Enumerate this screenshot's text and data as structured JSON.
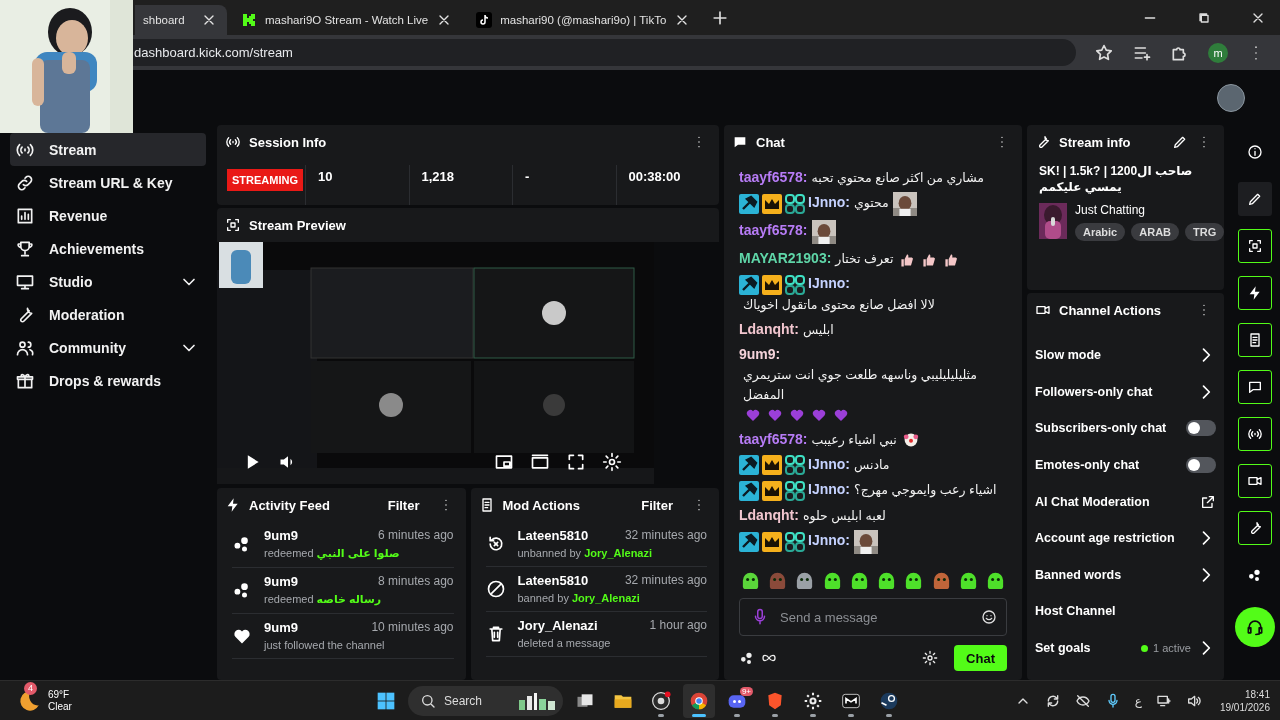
{
  "webcam": {
    "kind": "picture"
  },
  "browser": {
    "tabs": [
      {
        "label": "shboard",
        "selected": true,
        "kind": "page"
      },
      {
        "label": "mashari9O Stream - Watch Live",
        "selected": false,
        "kind": "kick"
      },
      {
        "label": "mashari90 (@mashari9o) | TikTo",
        "selected": false,
        "kind": "tiktok"
      }
    ],
    "url": "dashboard.kick.com/stream",
    "profile": "m"
  },
  "sidebar": {
    "items": [
      {
        "label": "Stream",
        "kind": "stream",
        "selected": true,
        "expandable": false
      },
      {
        "label": "Stream URL & Key",
        "kind": "link",
        "selected": false,
        "expandable": false
      },
      {
        "label": "Revenue",
        "kind": "chart",
        "selected": false,
        "expandable": false
      },
      {
        "label": "Achievements",
        "kind": "trophy",
        "selected": false,
        "expandable": false
      },
      {
        "label": "Studio",
        "kind": "studio",
        "selected": false,
        "expandable": true
      },
      {
        "label": "Moderation",
        "kind": "wrench",
        "selected": false,
        "expandable": false
      },
      {
        "label": "Community",
        "kind": "people",
        "selected": false,
        "expandable": true
      },
      {
        "label": "Drops & rewards",
        "kind": "gift",
        "selected": false,
        "expandable": false
      }
    ]
  },
  "session": {
    "title": "Session Info",
    "status": "STREAMING",
    "stats": [
      "10",
      "1,218",
      "-",
      "00:38:00"
    ]
  },
  "preview": {
    "title": "Stream Preview",
    "video": {
      "kind": "picture"
    }
  },
  "activity": {
    "title": "Activity Feed",
    "filter": "Filter",
    "items": [
      {
        "kind": "redeem",
        "user": "9um9",
        "time": "6 minutes ago",
        "action": "redeemed",
        "detail": "صلوا على النبي"
      },
      {
        "kind": "redeem",
        "user": "9um9",
        "time": "8 minutes ago",
        "action": "redeemed",
        "detail": "رساله خاصه"
      },
      {
        "kind": "follow",
        "user": "9um9",
        "time": "10 minutes ago",
        "action": "just followed the channel"
      }
    ]
  },
  "mod_actions": {
    "title": "Mod Actions",
    "filter": "Filter",
    "items": [
      {
        "kind": "unban",
        "user": "Lateen5810",
        "time": "32 minutes ago",
        "action": "unbanned by",
        "detail": "Jory_Alenazi"
      },
      {
        "kind": "ban",
        "user": "Lateen5810",
        "time": "32 minutes ago",
        "action": "banned by",
        "detail": "Jory_Alenazi"
      },
      {
        "kind": "delete",
        "user": "Jory_Alenazi",
        "time": "1 hour ago",
        "action": "deleted a message"
      }
    ]
  },
  "chat": {
    "title": "Chat",
    "messages": [
      {
        "user": "taayf6578:",
        "color": "#b77cf6",
        "text": "مشاري من اكثر صانع محتوي تحبه"
      },
      {
        "user": "IJnno:",
        "color": "#c5d2ff",
        "badges": [
          {
            "kind": "moderator"
          },
          {
            "kind": "vip"
          },
          {
            "kind": "og"
          }
        ],
        "text": "محتوي",
        "extras": [
          {
            "kind": "picture"
          }
        ]
      },
      {
        "user": "taayf6578:",
        "color": "#b77cf6",
        "extras": [
          {
            "kind": "picture"
          }
        ]
      },
      {
        "user": "MAYAR21903:",
        "color": "#5fd6a8",
        "text": "تعرف تختار",
        "extras": [
          {
            "kind": "thumbs"
          },
          {
            "kind": "thumbs"
          },
          {
            "kind": "thumbs"
          }
        ]
      },
      {
        "user": "IJnno:",
        "color": "#c5d2ff",
        "badges": [
          {
            "kind": "moderator"
          },
          {
            "kind": "vip"
          },
          {
            "kind": "og"
          }
        ],
        "text": "لالا افضل صانع محتوى ماتقول اخوياك"
      },
      {
        "user": "Ldanqht:",
        "color": "#f2c6cf",
        "text": "ابليس"
      },
      {
        "user": "9um9:",
        "color": "#f5d3da",
        "text": "مثليليليليبي وناسهه طلعت جوي انت ستريمري المفضل",
        "extras": [
          {
            "kind": "heart"
          },
          {
            "kind": "heart"
          },
          {
            "kind": "heart"
          },
          {
            "kind": "heart"
          },
          {
            "kind": "heart"
          }
        ]
      },
      {
        "user": "taayf6578:",
        "color": "#b77cf6",
        "text": "نبي اشياء رعيبب",
        "extras": [
          {
            "kind": "clown"
          }
        ]
      },
      {
        "user": "IJnno:",
        "color": "#c5d2ff",
        "badges": [
          {
            "kind": "moderator"
          },
          {
            "kind": "vip"
          },
          {
            "kind": "og"
          }
        ],
        "text": "مادنس"
      },
      {
        "user": "IJnno:",
        "color": "#c5d2ff",
        "badges": [
          {
            "kind": "moderator"
          },
          {
            "kind": "vip"
          },
          {
            "kind": "og"
          }
        ],
        "text": "اشياء رعب وايموجي مهرج؟"
      },
      {
        "user": "Ldanqht:",
        "color": "#f2c6cf",
        "text": "لعبه ابليس حلوه"
      },
      {
        "user": "IJnno:",
        "color": "#c5d2ff",
        "badges": [
          {
            "kind": "moderator"
          },
          {
            "kind": "vip"
          },
          {
            "kind": "og"
          }
        ],
        "extras": [
          {
            "kind": "picture"
          }
        ]
      }
    ],
    "placeholder": "Send a message",
    "send": "Chat"
  },
  "stream_info": {
    "title": "Stream info",
    "stream_title": "SK! | 1.5k? | صاحب ال1200 يمسي عليكمم",
    "category": "Just Chatting",
    "tags": [
      "Arabic",
      "ARAB",
      "TRG"
    ]
  },
  "channel_actions": {
    "title": "Channel Actions",
    "items": [
      {
        "label": "Slow mode",
        "kind": "link"
      },
      {
        "label": "Followers-only chat",
        "kind": "link"
      },
      {
        "label": "Subscribers-only chat",
        "kind": "toggle",
        "on": false
      },
      {
        "label": "Emotes-only chat",
        "kind": "toggle",
        "on": false
      },
      {
        "label": "AI Chat Moderation",
        "kind": "external"
      },
      {
        "label": "Account age restriction",
        "kind": "link"
      },
      {
        "label": "Banned words",
        "kind": "link"
      },
      {
        "label": "Host Channel",
        "kind": "plain"
      },
      {
        "label": "Set goals",
        "kind": "goal",
        "status": "1 active"
      }
    ]
  },
  "rail": [
    {
      "kind": "info",
      "active": false,
      "selected": false
    },
    {
      "kind": "edit",
      "active": false,
      "selected": true
    },
    {
      "kind": "preview",
      "active": true,
      "selected": false
    },
    {
      "kind": "bolt",
      "active": true,
      "selected": false
    },
    {
      "kind": "note",
      "active": true,
      "selected": false
    },
    {
      "kind": "chat",
      "active": true,
      "selected": false
    },
    {
      "kind": "stream",
      "active": true,
      "selected": false
    },
    {
      "kind": "camera",
      "active": true,
      "selected": false
    },
    {
      "kind": "wrench",
      "active": true,
      "selected": false
    },
    {
      "kind": "kick",
      "active": false,
      "selected": false
    },
    {
      "kind": "support"
    }
  ],
  "taskbar": {
    "weather": {
      "badge": "4",
      "temp": "69°F",
      "condition": "Clear"
    },
    "search": "Search",
    "apps": [
      {
        "kind": "taskview",
        "active": false,
        "running": false
      },
      {
        "kind": "folder",
        "active": false,
        "running": false
      },
      {
        "kind": "recorder",
        "active": false,
        "running": true
      },
      {
        "kind": "browser",
        "active": true,
        "running": true
      },
      {
        "kind": "discord",
        "active": false,
        "running": true,
        "badge": "9+"
      },
      {
        "kind": "shield",
        "active": false,
        "running": true
      },
      {
        "kind": "gear",
        "active": false,
        "running": true
      },
      {
        "kind": "app",
        "active": false,
        "running": true
      },
      {
        "kind": "steam",
        "active": false,
        "running": true
      }
    ],
    "language": "ع",
    "time": "18:41",
    "date": "19/01/2026"
  }
}
